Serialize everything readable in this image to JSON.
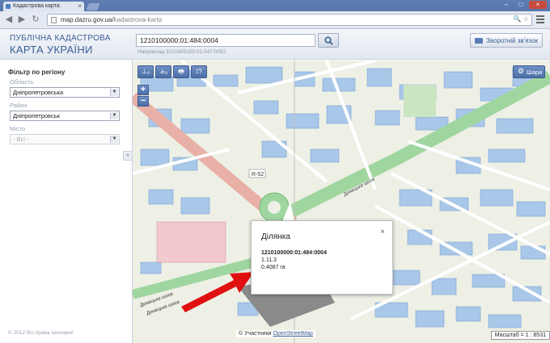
{
  "browser": {
    "tab_title": "Кадастрова карта",
    "url_host": "map.dazru.gov.ua/",
    "url_path": "kadastrova-karta",
    "omni_icons": "🔍 ☆"
  },
  "header": {
    "logo_line1": "ПУБЛІЧНА КАДАСТРОВА",
    "logo_line2": "КАРТА УКРАЇНИ",
    "search_value": "1210100000:01:484:0004",
    "search_example": "Наприклад 3221655100:01:047:0052",
    "feedback_label": "Зворотній зв'язок"
  },
  "sidebar": {
    "filter_title": "Фільтр по регіону",
    "oblast_label": "Область",
    "oblast_value": "Дніпропетровська",
    "raion_label": "Район",
    "raion_value": "Дніпропетровськ",
    "misto_label": "Місто",
    "misto_value": "- Всі -",
    "collapse_glyph": "«",
    "copyright": "© 2012 Всі права захищені"
  },
  "map": {
    "toolbar": [
      "⊥ᵤ",
      "⊥̶ᵤ",
      "🖶",
      "⟟?"
    ],
    "zoom_in": "+",
    "zoom_out": "−",
    "layers_label": "Шари",
    "attribution_prefix": "© Участники",
    "attribution_link": "OpenStreetMap",
    "scale_label": "Масштаб = 1 : 8531",
    "road_labels": [
      "Донецьке шосе",
      "Донецьке шосе",
      "Донецьке шосе"
    ],
    "road_badge": "R-52",
    "colors": {
      "parcel": "#a9c7e8",
      "parcel_stroke": "#7aa3d3",
      "road_green": "#9fd6a0",
      "road_main": "#e8b0a6",
      "arrow": "#e01010"
    }
  },
  "popup": {
    "title": "Ділянка",
    "cadastral_number": "1210100000:01:484:0004",
    "line2": "1.11.3",
    "area": "0.4087 га",
    "close_glyph": "×"
  }
}
